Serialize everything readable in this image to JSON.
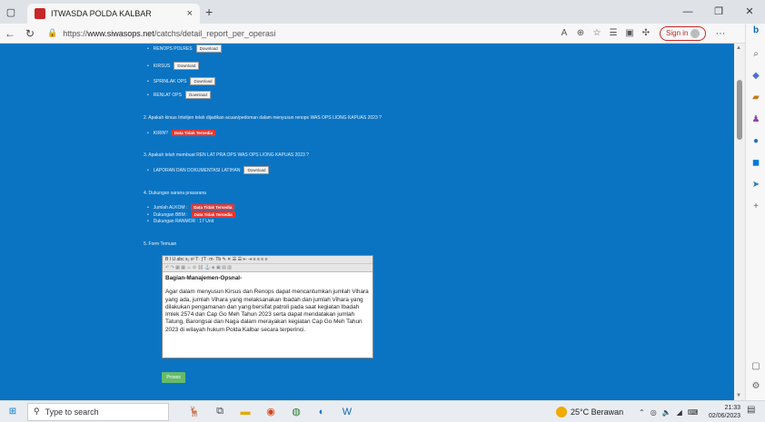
{
  "browser": {
    "tab_title": "ITWASDA POLDA KALBAR",
    "tab_close": "×",
    "new_tab": "+",
    "url_prefix": "https://",
    "url_host": "www.siwasops.net",
    "url_path": "/catchs/detail_report_per_operasi",
    "sign_in": "Sign in",
    "more": "···"
  },
  "content": {
    "top_items": [
      {
        "label": "RENOPS POLRES",
        "button": "Download"
      },
      {
        "label": "KIRSUS",
        "button": "Download"
      },
      {
        "label": "SPRINLAK OPS",
        "button": "Download"
      },
      {
        "label": "RENLAT OPS",
        "button": "Download"
      }
    ],
    "q2": "2. Apakah kirsus Intelijen telah dijadikan acuan/pedoman dalam menyusun renops WAS OPS LIONG KAPUAS 2023 ?",
    "q2_item": {
      "label": "KIRIN?",
      "badge": "Data Tidak Tersedia"
    },
    "q3": "3. Apakah telah membuat REN LAT PRA OPS WAS OPS LIONG KAPUAS 2023 ?",
    "q3_item": {
      "label": "LAPORAN DAN DOKUMENTASI LATIHAN",
      "button": "Download"
    },
    "q4": "4. Dukungan sarana prasarana",
    "q4_items": [
      {
        "label": "Jumlah ALKOM :",
        "badge": "Data Tidak Tersedia"
      },
      {
        "label": "Dukungan BBM :",
        "badge": "Data Tidak Tersedia"
      },
      {
        "label": "Dukungan RANMOR : 17 Unit",
        "badge": ""
      }
    ],
    "q5": "5. Form Temuan",
    "editor_toolbar": "B  I  U  abc  x₂  x²  T·  ƒT·  m·  Tb  ✎  ✕  ☰  ☰  ⇤  ⇥  ≡  ≡  ≡  ≡",
    "editor_toolbar2": "↶  ↷  ▦  ▦  ☺  ⊘  ⛓  ⚓  ◈  ▣  ▤  ▥",
    "editor_heading": "Bagian-Manajemen-Opsnal-",
    "editor_body": "Agar dalam menyusun Kirsus dan Renops dapat mencantumkan jumlah Vihara yang ada, jumlah Vihara yang melaksanakan Ibadah dan jumlah Vihara yang dilakukan pengamanan dan yang bersifat patroli pada saat kegiatan Ibadah Imlek 2574 dan Cap Go Meh Tahun 2023 serta dapat mendatakan jumlah Tatung, Barongsai dan Naga dalam merayakan kegiatan Cap Go Meh Tahun 2023 di wilayah hukum Polda Kalbar secara terperinci.",
    "submit": "Proses"
  },
  "taskbar": {
    "search_placeholder": "Type to search",
    "weather": "25°C Berawan",
    "time": "21:33",
    "date": "02/06/2023"
  }
}
